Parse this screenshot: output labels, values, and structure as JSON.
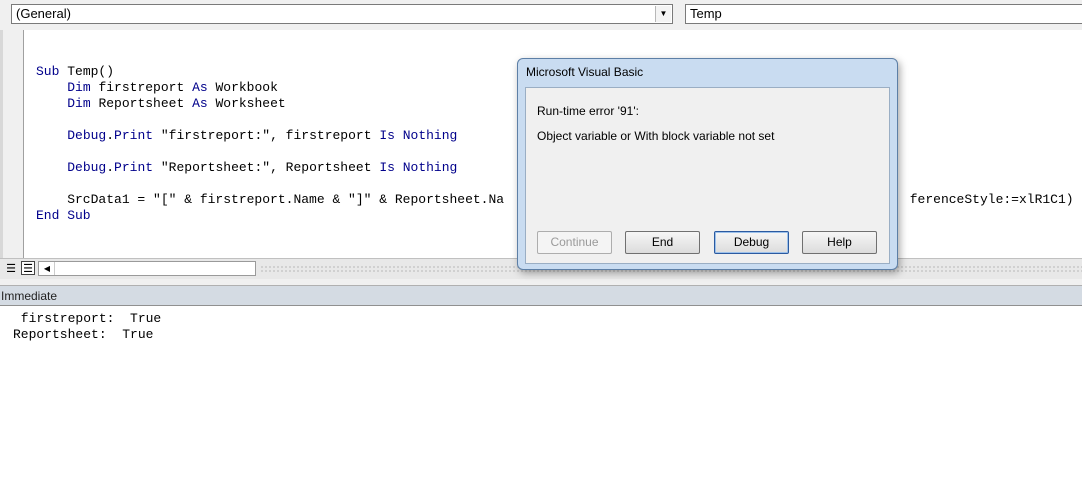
{
  "toolbar": {
    "object_combo": "(General)",
    "procedure_combo": "Temp"
  },
  "code": {
    "lines": [
      {
        "parts": [
          {
            "t": "Sub ",
            "k": true
          },
          {
            "t": "Temp()",
            "k": false
          }
        ]
      },
      {
        "parts": [
          {
            "t": "    ",
            "k": false
          },
          {
            "t": "Dim ",
            "k": true
          },
          {
            "t": "firstreport ",
            "k": false
          },
          {
            "t": "As ",
            "k": true
          },
          {
            "t": "Workbook",
            "k": false
          }
        ]
      },
      {
        "parts": [
          {
            "t": "    ",
            "k": false
          },
          {
            "t": "Dim ",
            "k": true
          },
          {
            "t": "Reportsheet ",
            "k": false
          },
          {
            "t": "As ",
            "k": true
          },
          {
            "t": "Worksheet",
            "k": false
          }
        ]
      },
      {
        "parts": []
      },
      {
        "parts": [
          {
            "t": "    ",
            "k": false
          },
          {
            "t": "Debug",
            "k": true
          },
          {
            "t": ".",
            "k": false
          },
          {
            "t": "Print",
            "k": true
          },
          {
            "t": " \"firstreport:\", firstreport ",
            "k": false
          },
          {
            "t": "Is Nothing",
            "k": true
          }
        ]
      },
      {
        "parts": []
      },
      {
        "parts": [
          {
            "t": "    ",
            "k": false
          },
          {
            "t": "Debug",
            "k": true
          },
          {
            "t": ".",
            "k": false
          },
          {
            "t": "Print",
            "k": true
          },
          {
            "t": " \"Reportsheet:\", Reportsheet ",
            "k": false
          },
          {
            "t": "Is Nothing",
            "k": true
          }
        ]
      },
      {
        "parts": []
      },
      {
        "parts": [
          {
            "t": "    SrcData1 = \"[\" & firstreport.Name & \"]\" & Reportsheet.Na",
            "k": false
          },
          {
            "t": "                                                    ",
            "k": false
          },
          {
            "t": "ferenceStyle:=xlR1C1)",
            "k": false
          }
        ]
      },
      {
        "parts": [
          {
            "t": "End Sub",
            "k": true
          }
        ]
      }
    ]
  },
  "immediate": {
    "title": "Immediate",
    "lines": [
      " firstreport:  True",
      "Reportsheet:  True"
    ]
  },
  "dialog": {
    "title": "Microsoft Visual Basic",
    "error_line": "Run-time error '91':",
    "message": "Object variable or With block variable not set",
    "buttons": {
      "continue": "Continue",
      "end": "End",
      "debug": "Debug",
      "help": "Help"
    }
  }
}
